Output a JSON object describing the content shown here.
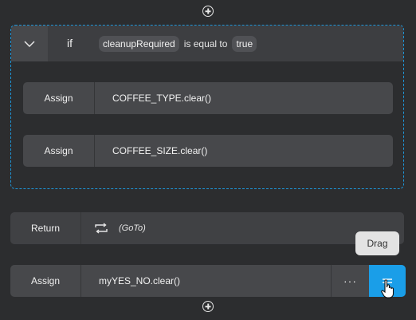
{
  "if_block": {
    "keyword": "if",
    "condition": {
      "variable": "cleanupRequired",
      "operator": "is equal to",
      "value": "true"
    },
    "statements": [
      {
        "keyword": "Assign",
        "expression": "COFFEE_TYPE.clear()"
      },
      {
        "keyword": "Assign",
        "expression": "COFFEE_SIZE.clear()"
      }
    ]
  },
  "return_row": {
    "keyword": "Return",
    "goto_label": "(GoTo)"
  },
  "assign_row": {
    "keyword": "Assign",
    "expression": "myYES_NO.clear()",
    "more_label": "···"
  },
  "tooltip": {
    "text": "Drag"
  },
  "colors": {
    "background": "#2c2d2f",
    "accent": "#1a9ee8",
    "dashed_border": "#1e95d8"
  },
  "icons": [
    "plus-circle-icon",
    "chevron-down-icon",
    "loop-arrows-icon",
    "drag-handle-icon",
    "hand-pointer-icon"
  ]
}
